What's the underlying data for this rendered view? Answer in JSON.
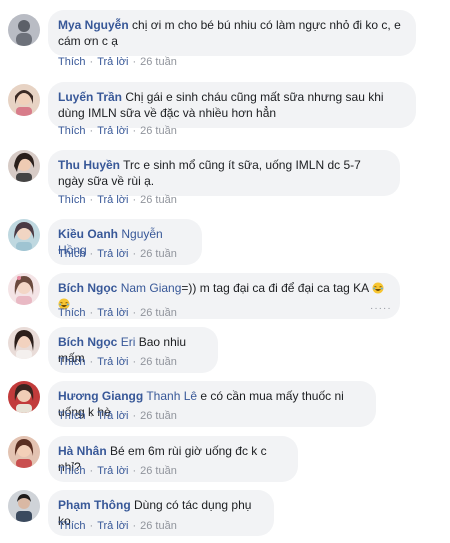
{
  "comments": [
    {
      "author": "Mya Nguyễn",
      "text": "chị ơi m cho bé bú nhiu có làm ngực nhỏ đi ko c, e cám ơn c ạ",
      "like": "Thích",
      "reply": "Trả lời",
      "time": "26 tuần"
    },
    {
      "author": "Luyến Trần",
      "text": "Chị gái e sinh cháu cũng mất sữa nhưng sau khi dùng IMLN sữa về đặc và nhiều hơn hẳn",
      "like": "Thích",
      "reply": "Trả lời",
      "time": "26 tuần"
    },
    {
      "author": "Thu Huyền",
      "text": "Trc e sinh mổ cũng ít sữa, uống IMLN dc 5-7 ngày sữa về rùi ạ.",
      "like": "Thích",
      "reply": "Trả lời",
      "time": "26 tuần"
    },
    {
      "author": "Kiều Oanh",
      "tag": "Nguyễn Hồng",
      "text": "",
      "like": "Thích",
      "reply": "Trả lời",
      "time": "26 tuần"
    },
    {
      "author": "Bích Ngọc",
      "tag": "Nam Giang",
      "text": "=)) m tag đại ca đi để đại ca tag KA",
      "like": "Thích",
      "reply": "Trả lời",
      "time": "26 tuần"
    },
    {
      "author": "Bích Ngọc",
      "tag": "Eri",
      "text": "Bao nhiu mấm",
      "like": "Thích",
      "reply": "Trả lời",
      "time": "26 tuần"
    },
    {
      "author": "Hương Giangg",
      "tag": "Thanh Lê",
      "text": "e có cần mua mấy thuốc ni uống k hè",
      "like": "Thích",
      "reply": "Trả lời",
      "time": "26 tuần"
    },
    {
      "author": "Hà Nhân",
      "text": "Bé em 6m rùi giờ uống đc k c nhỉ?",
      "like": "Thích",
      "reply": "Trả lời",
      "time": "26 tuần"
    },
    {
      "author": "Phạm Thông",
      "text": "Dùng có tác dụng phụ ko",
      "like": "Thích",
      "reply": "Trả lời",
      "time": "26 tuần"
    }
  ],
  "colors": {
    "link": "#385898",
    "bubble": "#f2f3f5",
    "meta": "#90949c"
  }
}
